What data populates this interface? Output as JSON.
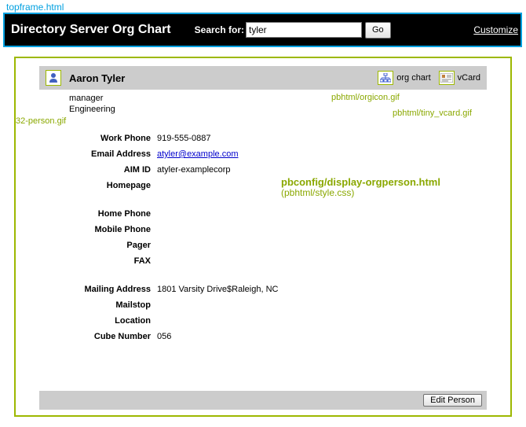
{
  "annotations": {
    "topframe": "topframe.html",
    "person_icon": "32-person.gif",
    "orgicon": "pbhtml/orgicon.gif",
    "vcard": "pbhtml/tiny_vcard.gif",
    "config_title": "pbconfig/display-orgperson.html",
    "config_sub": "(pbhtml/style.css)"
  },
  "topbar": {
    "title": "Directory Server Org Chart",
    "search_label": "Search for:",
    "search_value": "tyler",
    "go_label": "Go",
    "customize": "Customize"
  },
  "person": {
    "name": "Aaron Tyler",
    "title": "manager",
    "dept": "Engineering",
    "orgchart_label": "org chart",
    "vcard_label": "vCard"
  },
  "fields": {
    "work_phone": {
      "label": "Work Phone",
      "value": "919-555-0887"
    },
    "email": {
      "label": "Email Address",
      "value": "atyler@example.com"
    },
    "aim": {
      "label": "AIM ID",
      "value": "atyler-examplecorp"
    },
    "homepage": {
      "label": "Homepage",
      "value": ""
    },
    "home_phone": {
      "label": "Home Phone",
      "value": ""
    },
    "mobile": {
      "label": "Mobile Phone",
      "value": ""
    },
    "pager": {
      "label": "Pager",
      "value": ""
    },
    "fax": {
      "label": "FAX",
      "value": ""
    },
    "mailing": {
      "label": "Mailing Address",
      "value": "1801 Varsity Drive$Raleigh, NC"
    },
    "mailstop": {
      "label": "Mailstop",
      "value": ""
    },
    "location": {
      "label": "Location",
      "value": ""
    },
    "cube": {
      "label": "Cube Number",
      "value": "056"
    }
  },
  "buttons": {
    "edit": "Edit Person"
  }
}
